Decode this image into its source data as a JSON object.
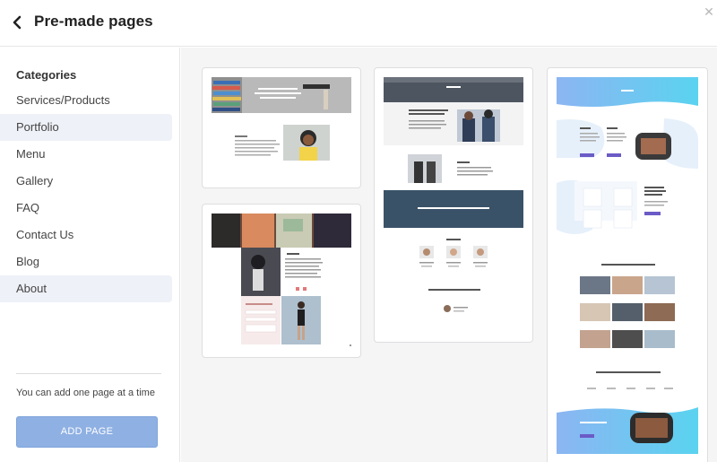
{
  "header": {
    "title": "Pre-made pages",
    "back_icon": "chevron-left-icon",
    "close_icon": "close-icon"
  },
  "sidebar": {
    "heading": "Categories",
    "items": [
      {
        "label": "Services/Products",
        "highlighted": false
      },
      {
        "label": "Portfolio",
        "highlighted": true
      },
      {
        "label": "Menu",
        "highlighted": false
      },
      {
        "label": "Gallery",
        "highlighted": false
      },
      {
        "label": "FAQ",
        "highlighted": false
      },
      {
        "label": "Contact Us",
        "highlighted": false
      },
      {
        "label": "Blog",
        "highlighted": false
      },
      {
        "label": "About",
        "highlighted": true
      }
    ],
    "hint": "You can add one page at a time",
    "add_button": "ADD PAGE"
  },
  "colors": {
    "add_button": "#8fb0e3",
    "highlight": "#eef1f7",
    "gradient_start": "#7fb8f0",
    "gradient_end": "#5ad3f0",
    "purple": "#6b5bc6"
  },
  "templates": [
    {
      "id": "about-books"
    },
    {
      "id": "about-business"
    },
    {
      "id": "about-team"
    },
    {
      "id": "about-fashion"
    }
  ]
}
